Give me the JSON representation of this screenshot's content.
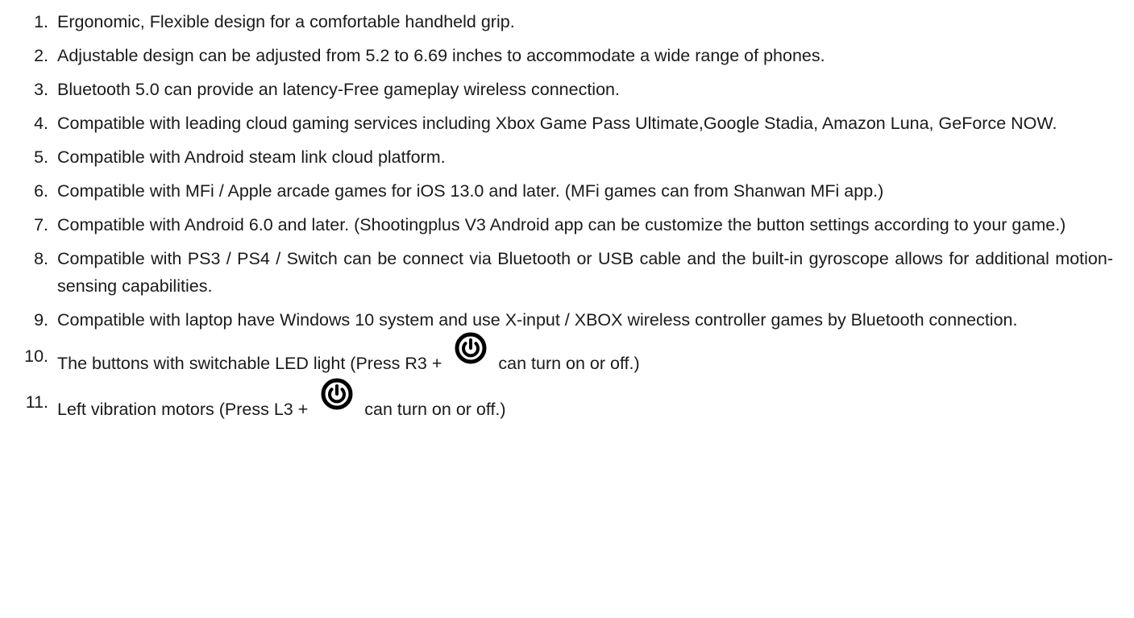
{
  "features": {
    "items": [
      {
        "number": "1.",
        "text": "Ergonomic, Flexible design for a comfortable handheld grip."
      },
      {
        "number": "2.",
        "text": "Adjustable design can be adjusted from 5.2 to 6.69 inches to accommodate a wide range of phones."
      },
      {
        "number": "3.",
        "text": "Bluetooth 5.0 can provide an latency-Free gameplay wireless connection."
      },
      {
        "number": "4.",
        "text": "Compatible with leading cloud gaming services including Xbox Game Pass Ultimate,Google Stadia, Amazon Luna, GeForce NOW."
      },
      {
        "number": "5.",
        "text": "Compatible with Android steam link cloud platform."
      },
      {
        "number": "6.",
        "text": "Compatible with MFi / Apple arcade games for iOS 13.0 and later. (MFi games can from Shanwan MFi app.)"
      },
      {
        "number": "7.",
        "text": "Compatible with Android 6.0 and later. (Shootingplus V3 Android app can be customize the button settings according to your game.)"
      },
      {
        "number": "8.",
        "text": "Compatible with PS3 / PS4 / Switch can be connect via Bluetooth or USB cable and the built-in gyroscope allows for additional motion-sensing capabilities."
      },
      {
        "number": "9.",
        "text": "Compatible with laptop have Windows 10 system and use X-input / XBOX wireless controller games by Bluetooth connection."
      },
      {
        "number": "10.",
        "before_icon": "The buttons with switchable LED light (Press R3 +",
        "after_icon": "can turn on or off.)",
        "icon": "power-icon"
      },
      {
        "number": "11.",
        "before_icon": "Left vibration motors (Press L3 +",
        "after_icon": "can turn on or off.)",
        "icon": "power-icon"
      }
    ]
  }
}
